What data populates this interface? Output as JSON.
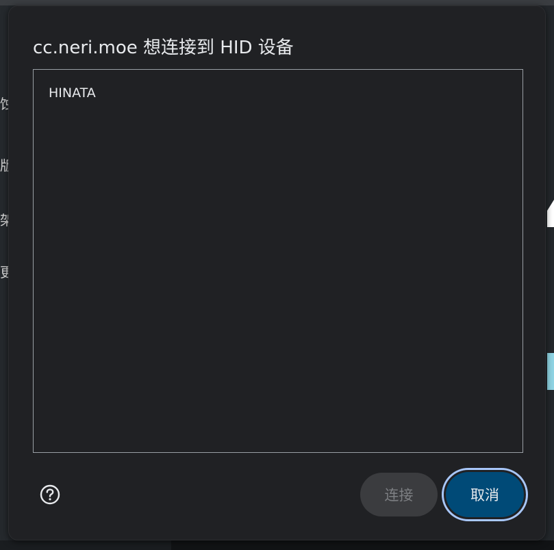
{
  "dialog": {
    "title": "cc.neri.moe 想连接到 HID 设备",
    "devices": [
      {
        "label": "HINATA"
      }
    ],
    "help_icon": "help-circle-icon",
    "connect_label": "连接",
    "cancel_label": "取消"
  },
  "background": {
    "side_chars": [
      "蚀",
      "版",
      "架",
      "更"
    ]
  },
  "colors": {
    "dialog_bg": "#202124",
    "text": "#e8eaed",
    "list_border": "#9aa0a6",
    "connect_bg_disabled": "#3b3c3f",
    "cancel_bg": "#004a77",
    "focus_ring": "#a8c7fa"
  }
}
